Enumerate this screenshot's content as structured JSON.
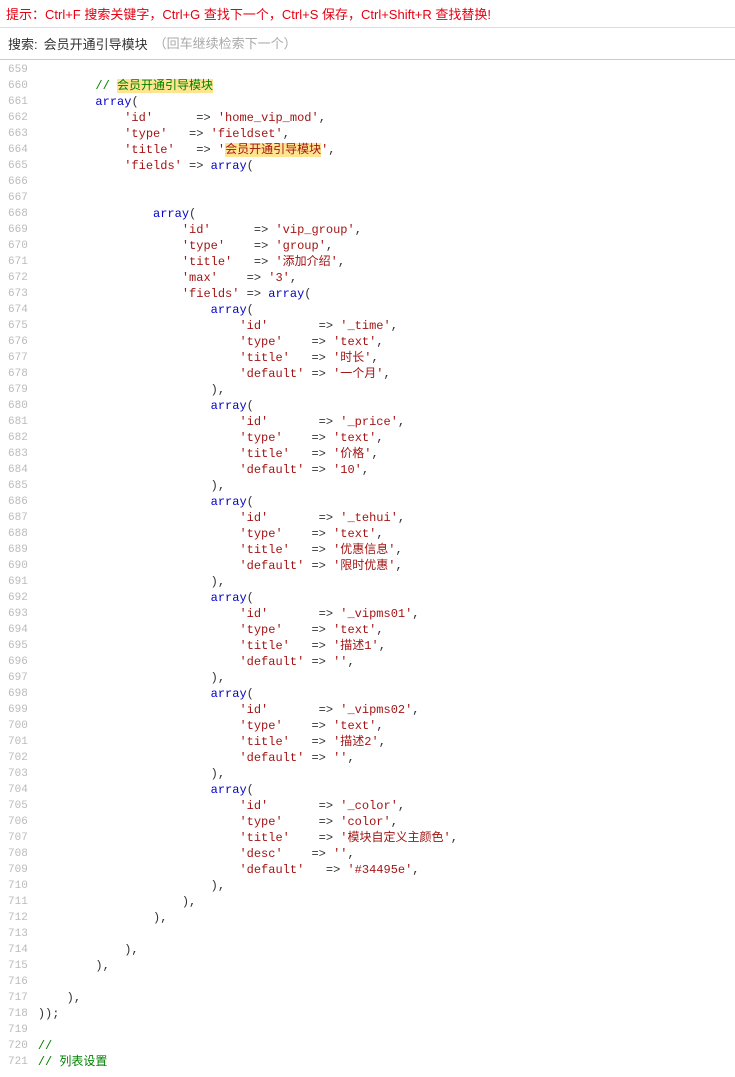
{
  "hint": "提示：Ctrl+F 搜索关键字，Ctrl+G 查找下一个，Ctrl+S 保存，Ctrl+Shift+R 查找替换!",
  "search": {
    "label": "搜索:",
    "value": "会员开通引导模块",
    "placeholder": "（回车继续检索下一个）"
  },
  "lines": [
    {
      "n": "659",
      "t": ""
    },
    {
      "n": "660",
      "t": "        // ",
      "cls": "cm",
      "rest": "会员开通引导模块",
      "hl": true,
      "cmrest": true
    },
    {
      "n": "661",
      "t": "        ",
      "kw": "array",
      "rest": "("
    },
    {
      "n": "662",
      "t": "            ",
      "s1": "'id'",
      "mid": "      => ",
      "s2": "'home_vip_mod'",
      "end": ","
    },
    {
      "n": "663",
      "t": "            ",
      "s1": "'type'",
      "mid": "   => ",
      "s2": "'fieldset'",
      "end": ","
    },
    {
      "n": "664",
      "t": "            ",
      "s1": "'title'",
      "mid": "   => ",
      "s2": "'会员开通引导模块'",
      "end": ",",
      "hl2": true
    },
    {
      "n": "665",
      "t": "            ",
      "s1": "'fields'",
      "mid": " => ",
      "kw": "array",
      "rest": "("
    },
    {
      "n": "666",
      "t": ""
    },
    {
      "n": "667",
      "t": ""
    },
    {
      "n": "668",
      "t": "                ",
      "kw": "array",
      "rest": "("
    },
    {
      "n": "669",
      "t": "                    ",
      "s1": "'id'",
      "mid": "      => ",
      "s2": "'vip_group'",
      "end": ","
    },
    {
      "n": "670",
      "t": "                    ",
      "s1": "'type'",
      "mid": "    => ",
      "s2": "'group'",
      "end": ","
    },
    {
      "n": "671",
      "t": "                    ",
      "s1": "'title'",
      "mid": "   => ",
      "s2": "'添加介绍'",
      "end": ","
    },
    {
      "n": "672",
      "t": "                    ",
      "s1": "'max'",
      "mid": "    => ",
      "s2": "'3'",
      "end": ","
    },
    {
      "n": "673",
      "t": "                    ",
      "s1": "'fields'",
      "mid": " => ",
      "kw": "array",
      "rest": "("
    },
    {
      "n": "674",
      "t": "                        ",
      "kw": "array",
      "rest": "("
    },
    {
      "n": "675",
      "t": "                            ",
      "s1": "'id'",
      "mid": "       => ",
      "s2": "'_time'",
      "end": ","
    },
    {
      "n": "676",
      "t": "                            ",
      "s1": "'type'",
      "mid": "    => ",
      "s2": "'text'",
      "end": ","
    },
    {
      "n": "677",
      "t": "                            ",
      "s1": "'title'",
      "mid": "   => ",
      "s2": "'时长'",
      "end": ","
    },
    {
      "n": "678",
      "t": "                            ",
      "s1": "'default'",
      "mid": " => ",
      "s2": "'一个月'",
      "end": ","
    },
    {
      "n": "679",
      "t": "                        ),"
    },
    {
      "n": "680",
      "t": "                        ",
      "kw": "array",
      "rest": "("
    },
    {
      "n": "681",
      "t": "                            ",
      "s1": "'id'",
      "mid": "       => ",
      "s2": "'_price'",
      "end": ","
    },
    {
      "n": "682",
      "t": "                            ",
      "s1": "'type'",
      "mid": "    => ",
      "s2": "'text'",
      "end": ","
    },
    {
      "n": "683",
      "t": "                            ",
      "s1": "'title'",
      "mid": "   => ",
      "s2": "'价格'",
      "end": ","
    },
    {
      "n": "684",
      "t": "                            ",
      "s1": "'default'",
      "mid": " => ",
      "s2": "'10'",
      "end": ","
    },
    {
      "n": "685",
      "t": "                        ),"
    },
    {
      "n": "686",
      "t": "                        ",
      "kw": "array",
      "rest": "("
    },
    {
      "n": "687",
      "t": "                            ",
      "s1": "'id'",
      "mid": "       => ",
      "s2": "'_tehui'",
      "end": ","
    },
    {
      "n": "688",
      "t": "                            ",
      "s1": "'type'",
      "mid": "    => ",
      "s2": "'text'",
      "end": ","
    },
    {
      "n": "689",
      "t": "                            ",
      "s1": "'title'",
      "mid": "   => ",
      "s2": "'优惠信息'",
      "end": ","
    },
    {
      "n": "690",
      "t": "                            ",
      "s1": "'default'",
      "mid": " => ",
      "s2": "'限时优惠'",
      "end": ","
    },
    {
      "n": "691",
      "t": "                        ),"
    },
    {
      "n": "692",
      "t": "                        ",
      "kw": "array",
      "rest": "("
    },
    {
      "n": "693",
      "t": "                            ",
      "s1": "'id'",
      "mid": "       => ",
      "s2": "'_vipms01'",
      "end": ","
    },
    {
      "n": "694",
      "t": "                            ",
      "s1": "'type'",
      "mid": "    => ",
      "s2": "'text'",
      "end": ","
    },
    {
      "n": "695",
      "t": "                            ",
      "s1": "'title'",
      "mid": "   => ",
      "s2": "'描述1'",
      "end": ","
    },
    {
      "n": "696",
      "t": "                            ",
      "s1": "'default'",
      "mid": " => ",
      "s2": "''",
      "end": ","
    },
    {
      "n": "697",
      "t": "                        ),"
    },
    {
      "n": "698",
      "t": "                        ",
      "kw": "array",
      "rest": "("
    },
    {
      "n": "699",
      "t": "                            ",
      "s1": "'id'",
      "mid": "       => ",
      "s2": "'_vipms02'",
      "end": ","
    },
    {
      "n": "700",
      "t": "                            ",
      "s1": "'type'",
      "mid": "    => ",
      "s2": "'text'",
      "end": ","
    },
    {
      "n": "701",
      "t": "                            ",
      "s1": "'title'",
      "mid": "   => ",
      "s2": "'描述2'",
      "end": ","
    },
    {
      "n": "702",
      "t": "                            ",
      "s1": "'default'",
      "mid": " => ",
      "s2": "''",
      "end": ","
    },
    {
      "n": "703",
      "t": "                        ),"
    },
    {
      "n": "704",
      "t": "                        ",
      "kw": "array",
      "rest": "("
    },
    {
      "n": "705",
      "t": "                            ",
      "s1": "'id'",
      "mid": "       => ",
      "s2": "'_color'",
      "end": ","
    },
    {
      "n": "706",
      "t": "                            ",
      "s1": "'type'",
      "mid": "     => ",
      "s2": "'color'",
      "end": ","
    },
    {
      "n": "707",
      "t": "                            ",
      "s1": "'title'",
      "mid": "    => ",
      "s2": "'模块自定义主颜色'",
      "end": ","
    },
    {
      "n": "708",
      "t": "                            ",
      "s1": "'desc'",
      "mid": "    => ",
      "s2": "''",
      "end": ","
    },
    {
      "n": "709",
      "t": "                            ",
      "s1": "'default'",
      "mid": "   => ",
      "s2": "'#34495e'",
      "end": ","
    },
    {
      "n": "710",
      "t": "                        ),"
    },
    {
      "n": "711",
      "t": "                    ),"
    },
    {
      "n": "712",
      "t": "                ),"
    },
    {
      "n": "713",
      "t": ""
    },
    {
      "n": "714",
      "t": "            ),"
    },
    {
      "n": "715",
      "t": "        ),"
    },
    {
      "n": "716",
      "t": ""
    },
    {
      "n": "717",
      "t": "    ),"
    },
    {
      "n": "718",
      "t": "));"
    },
    {
      "n": "719",
      "t": ""
    },
    {
      "n": "720",
      "t": "",
      "cm": "//"
    },
    {
      "n": "721",
      "t": "",
      "cm": "// 列表设置"
    }
  ]
}
